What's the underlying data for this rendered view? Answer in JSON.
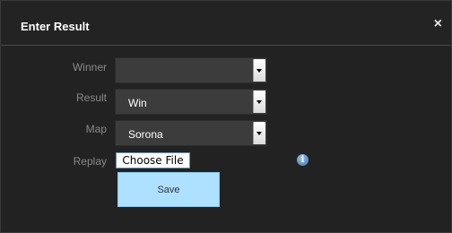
{
  "dialog": {
    "title": "Enter Result",
    "close_icon": "×"
  },
  "form": {
    "winner": {
      "label": "Winner",
      "value": ""
    },
    "result": {
      "label": "Result",
      "value": "Win"
    },
    "map": {
      "label": "Map",
      "value": "Sorona"
    },
    "replay": {
      "label": "Replay",
      "button_label": "Choose File",
      "info_icon": "i"
    },
    "save_label": "Save"
  }
}
